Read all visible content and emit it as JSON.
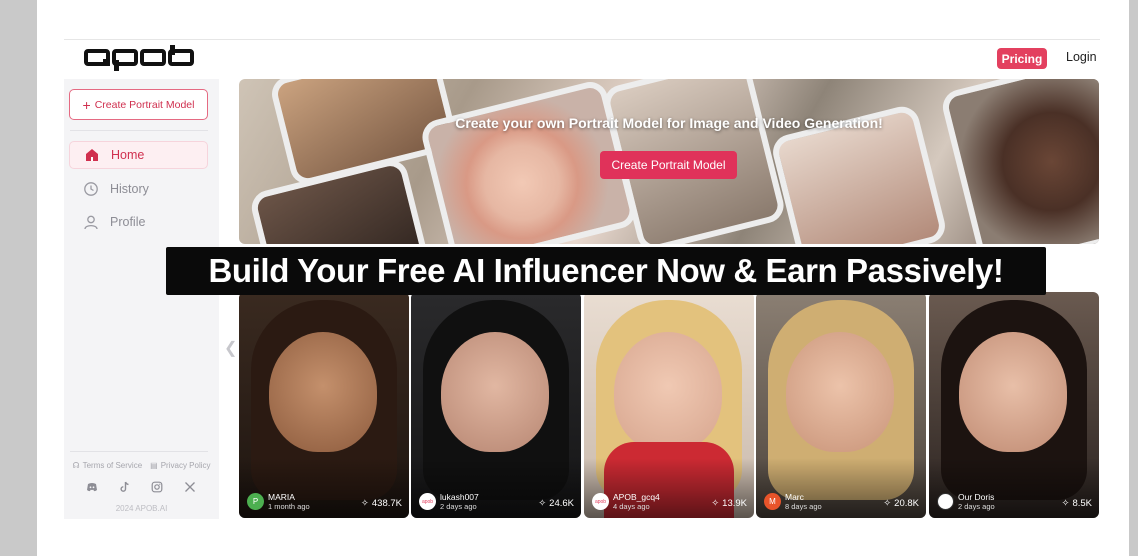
{
  "brand": {
    "logo_text": "apob"
  },
  "header": {
    "pricing_label": "Pricing",
    "login_label": "Login"
  },
  "sidebar": {
    "create_label": "Create Portrait Model",
    "items": [
      {
        "label": "Home",
        "icon": "home-icon",
        "active": true
      },
      {
        "label": "History",
        "icon": "clock-icon",
        "active": false
      },
      {
        "label": "Profile",
        "icon": "user-icon",
        "active": false
      }
    ],
    "footer": {
      "terms": "Terms of Service",
      "privacy": "Privacy Policy",
      "copyright": "2024 APOB.AI",
      "social_icons": [
        "discord-icon",
        "tiktok-icon",
        "instagram-icon",
        "x-icon"
      ]
    }
  },
  "hero": {
    "title": "Create your own Portrait Model for Image and Video Generation!",
    "button_label": "Create Portrait Model"
  },
  "banner": {
    "text": "Build Your Free AI Influencer Now & Earn Passively!"
  },
  "cards": [
    {
      "name": "MARIA",
      "time": "1 month ago",
      "count": "438.7K",
      "avatar": "P",
      "avatar_color": "#4caf50"
    },
    {
      "name": "lukash007",
      "time": "2 days ago",
      "count": "24.6K",
      "avatar": "apob",
      "avatar_color": "#ffffff"
    },
    {
      "name": "APOB_gcq4",
      "time": "4 days ago",
      "count": "13.9K",
      "avatar": "apob",
      "avatar_color": "#ffffff"
    },
    {
      "name": "Marc",
      "time": "8 days ago",
      "count": "20.8K",
      "avatar": "M",
      "avatar_color": "#e8542a"
    },
    {
      "name": "Our Doris",
      "time": "2 days ago",
      "count": "8.5K",
      "avatar": "",
      "avatar_color": "#ffffff"
    }
  ],
  "colors": {
    "accent": "#e3405f",
    "sidebar_bg": "#f4f4f6",
    "banner_bg": "#0a0a0a"
  }
}
